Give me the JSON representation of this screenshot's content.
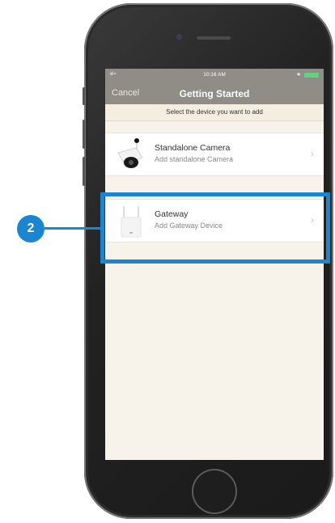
{
  "status_bar": {
    "signal": "ııl ≈",
    "time": "10:16 AM",
    "bluetooth": "∗"
  },
  "nav": {
    "cancel_label": "Cancel",
    "title": "Getting Started"
  },
  "instruction": "Select the device you want to add",
  "devices": [
    {
      "name": "Standalone Camera",
      "description": "Add standalone Camera",
      "icon": "camera-icon"
    },
    {
      "name": "Gateway",
      "description": "Add Gateway Device",
      "icon": "gateway-icon"
    }
  ],
  "callout": {
    "number": "2",
    "color": "#1a86d2"
  }
}
